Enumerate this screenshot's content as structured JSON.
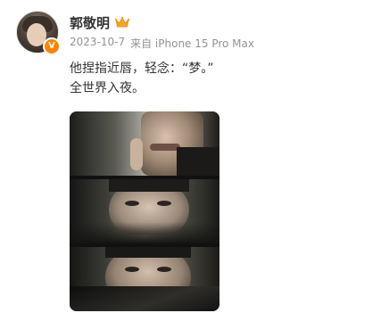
{
  "post": {
    "username": "郭敬明",
    "date": "2023-10-7",
    "source": "来自 iPhone 15 Pro Max",
    "content_lines": [
      "他捏指近唇，轻念：“梦。”",
      "全世界入夜。"
    ],
    "verified_badge": "V"
  },
  "icons": {
    "crown": "crown-icon",
    "verified": "verified-badge-icon"
  },
  "colors": {
    "username": "#333333",
    "meta": "#939393",
    "badge": "#ff8200",
    "crown": "#f5a623"
  }
}
